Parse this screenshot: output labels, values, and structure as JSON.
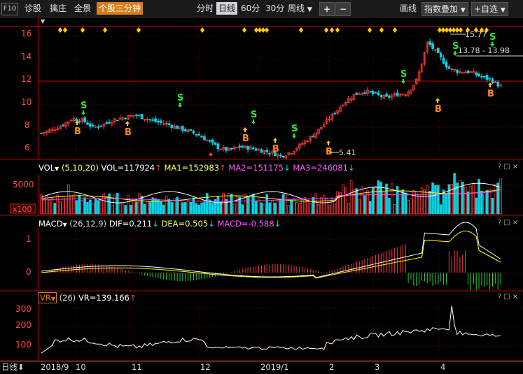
{
  "toolbar": {
    "f10": "F10",
    "diagnose": "诊股",
    "capture": "擒庄",
    "overview": "全景",
    "stock_3min": "个股三分钟",
    "intraday": "分时",
    "daily": "日线",
    "m60": "60分",
    "m30": "30分",
    "weekly": "周线",
    "plus": "+",
    "minus": "−",
    "draw": "画线",
    "index_overlay": "指数叠加",
    "add_watch": "+自选"
  },
  "main_panel": {
    "price_ticks": [
      "16",
      "14",
      "12",
      "10",
      "8",
      "6"
    ],
    "high_label": "15.77",
    "low_label": "5.41",
    "range_label": "13.78 - 13.98",
    "signal_buy": "B",
    "signal_sell": "S"
  },
  "vol_panel": {
    "name": "VOL",
    "params": "(5,10,20)",
    "vol": "VOL=117924",
    "ma1": "MA1=152983",
    "ma2": "MA2=151175",
    "ma3": "MA3=246081",
    "tick": "5000",
    "unit": "x100"
  },
  "macd_panel": {
    "name": "MACD",
    "params": "(26,12,9)",
    "dif": "DIF=0.211",
    "dea": "DEA=0.505",
    "macd": "MACD=-0.588",
    "ticks": [
      "1",
      "0"
    ]
  },
  "vr_panel": {
    "name": "VR",
    "params": "(26)",
    "vr": "VR=139.166",
    "ticks": [
      "300",
      "200",
      "100"
    ]
  },
  "date_axis": {
    "period": "日线",
    "labels": [
      "2018/9",
      "10",
      "11",
      "12",
      "2019/1",
      "2",
      "3",
      "4"
    ]
  },
  "panel_controls": "?□×",
  "colors": {
    "up": "#ff3b3b",
    "down": "#00d4e6",
    "ma1": "#ffffff",
    "ma2": "#ffff00",
    "ma3": "#ff40ff",
    "accent": "#d87c1a",
    "signal": "#ffd000"
  },
  "chart_data": {
    "type": "candlestick",
    "x_range": [
      "2018/9",
      "2019/4"
    ],
    "price_range": [
      5,
      16.5
    ],
    "key_prices": {
      "high": 15.77,
      "low": 5.41,
      "last_range": [
        13.78,
        13.98
      ]
    },
    "close_path": [
      7.5,
      7.8,
      8.2,
      8.8,
      8.6,
      8.0,
      8.3,
      8.7,
      8.9,
      9.1,
      8.8,
      8.5,
      8.3,
      8.0,
      7.7,
      7.4,
      6.8,
      6.2,
      6.0,
      6.3,
      6.2,
      6.0,
      5.8,
      5.5,
      5.9,
      6.6,
      7.3,
      8.2,
      9.2,
      10.2,
      10.9,
      11.2,
      10.9,
      10.6,
      10.9,
      11.0,
      12.2,
      15.5,
      14.4,
      13.2,
      12.9,
      12.9,
      12.5,
      12.2,
      11.6
    ]
  }
}
